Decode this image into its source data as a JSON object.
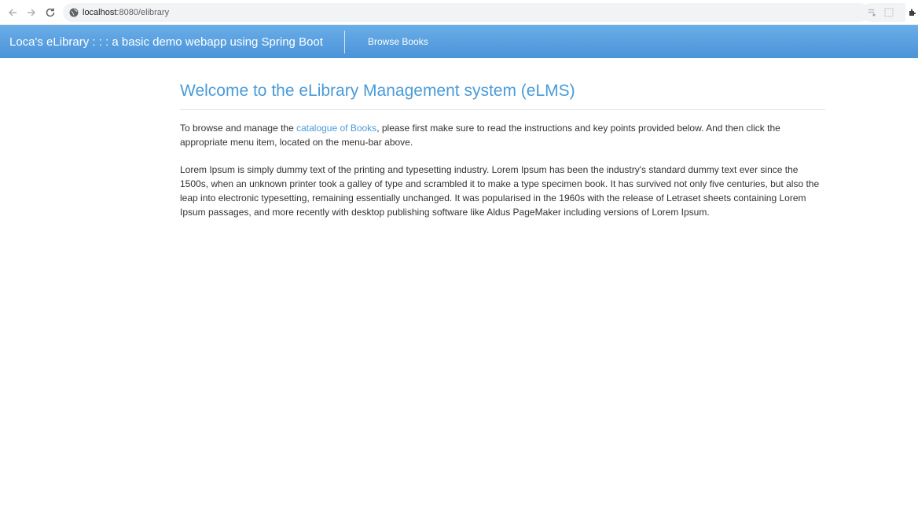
{
  "browser": {
    "url_host": "localhost",
    "url_path": ":8080/elibrary"
  },
  "navbar": {
    "brand": "Loca's eLibrary : : : a basic demo webapp using Spring Boot",
    "browse_books": "Browse Books",
    "gradient_top": "#6aaee8",
    "gradient_bottom": "#4b93d8"
  },
  "main": {
    "title": "Welcome to the eLibrary Management system (eLMS)",
    "intro_before": "To browse and manage the ",
    "intro_link": "catalogue of Books",
    "intro_after": ", please first make sure to read the instructions and key points provided below. And then click the appropriate menu item, located on the menu-bar above.",
    "lorem": "Lorem Ipsum is simply dummy text of the printing and typesetting industry. Lorem Ipsum has been the industry's standard dummy text ever since the 1500s, when an unknown printer took a galley of type and scrambled it to make a type specimen book. It has survived not only five centuries, but also the leap into electronic typesetting, remaining essentially unchanged. It was popularised in the 1960s with the release of Letraset sheets containing Lorem Ipsum passages, and more recently with desktop publishing software like Aldus PageMaker including versions of Lorem Ipsum.",
    "accent_color": "#4a9bd9"
  }
}
